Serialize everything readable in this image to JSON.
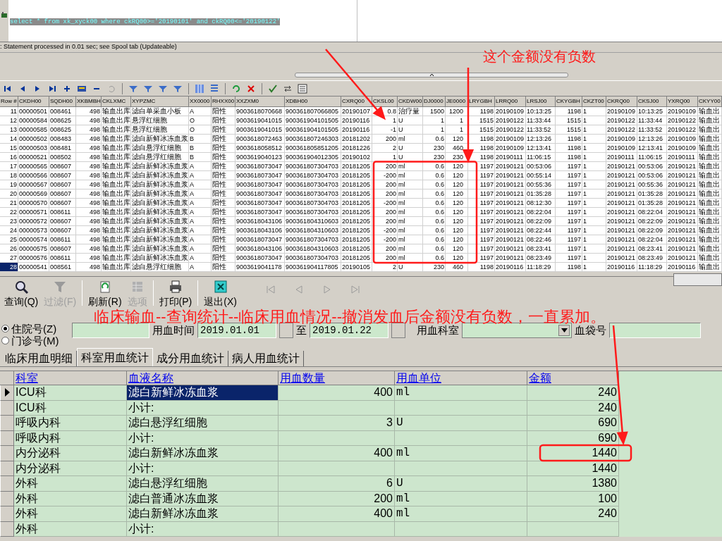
{
  "sql_editor": {
    "query": "select * from xk_xyck00 where ckRQ00>='20190101' and ckRQ00<='20190122'"
  },
  "status_message": ": Statement processed in 0.01 sec; see Spool tab (Updateable)",
  "result_grid": {
    "columns": [
      "Row #",
      "CKDH00",
      "SQDH00",
      "XKBMBH",
      "CKLXMC",
      "XYPZMC",
      "XX0000",
      "RHXX00",
      "XXZXM0",
      "XDBH00",
      "CXRQ00",
      "CKSL00",
      "CKDW00",
      "DJ0000",
      "JE0000",
      "LRYGBH",
      "LRRQ00",
      "LRSJ00",
      "CKYGBH",
      "CKZT00",
      "CKRQ00",
      "CKSJ00",
      "YXRQ00",
      "CKYY00"
    ],
    "rows": [
      {
        "selected": false,
        "cells": [
          "11",
          "00000501",
          "008461",
          "498",
          "输血出库",
          "滤白单采血小板",
          "A",
          "阳性",
          "9003618070668",
          "900361807066805",
          "20190107",
          "0.8",
          "治疗量",
          "1500",
          "1200",
          "1198",
          "20190109",
          "10:13:25",
          "1198",
          "1",
          "20190109",
          "10:13:25",
          "20190109",
          "输血出"
        ]
      },
      {
        "selected": false,
        "cells": [
          "12",
          "00000584",
          "008625",
          "498",
          "输血出库",
          "悬浮红细胞",
          "O",
          "阳性",
          "9003619041015",
          "900361904101505",
          "20190116",
          "1",
          "U",
          "1",
          "1",
          "1515",
          "20190122",
          "11:33:44",
          "1515",
          "1",
          "20190122",
          "11:33:44",
          "20190122",
          "输血出"
        ]
      },
      {
        "selected": false,
        "cells": [
          "13",
          "00000585",
          "008625",
          "498",
          "输血出库",
          "悬浮红细胞",
          "O",
          "阳性",
          "9003619041015",
          "900361904101505",
          "20190116",
          "-1",
          "U",
          "1",
          "1",
          "1515",
          "20190122",
          "11:33:52",
          "1515",
          "1",
          "20190122",
          "11:33:52",
          "20190122",
          "输血出"
        ]
      },
      {
        "selected": false,
        "cells": [
          "14",
          "00000502",
          "008483",
          "498",
          "输血出库",
          "滤白新鲜冰冻血浆",
          "B",
          "阳性",
          "9003618072463",
          "900361807246303",
          "20181202",
          "200",
          "ml",
          "0.6",
          "120",
          "1198",
          "20190109",
          "12:13:26",
          "1198",
          "1",
          "20190109",
          "12:13:26",
          "20190109",
          "输血出"
        ]
      },
      {
        "selected": false,
        "cells": [
          "15",
          "00000503",
          "008481",
          "498",
          "输血出库",
          "滤白悬浮红细胞",
          "B",
          "阳性",
          "9003618058512",
          "900361805851205",
          "20181226",
          "2",
          "U",
          "230",
          "460",
          "1198",
          "20190109",
          "12:13:41",
          "1198",
          "1",
          "20190109",
          "12:13:41",
          "20190109",
          "输血出"
        ]
      },
      {
        "selected": false,
        "cells": [
          "16",
          "00000521",
          "008502",
          "498",
          "输血出库",
          "滤白悬浮红细胞",
          "B",
          "阳性",
          "9003619040123",
          "900361904012305",
          "20190102",
          "1",
          "U",
          "230",
          "230",
          "1198",
          "20190111",
          "11:06:15",
          "1198",
          "1",
          "20190111",
          "11:06:15",
          "20190111",
          "输血出"
        ]
      },
      {
        "selected": false,
        "cells": [
          "17",
          "00000565",
          "008607",
          "498",
          "输血出库",
          "滤白新鲜冰冻血浆",
          "A",
          "阳性",
          "9003618073047",
          "900361807304703",
          "20181205",
          "200",
          "ml",
          "0.6",
          "120",
          "1197",
          "20190121",
          "00:53:06",
          "1197",
          "1",
          "20190121",
          "00:53:06",
          "20190121",
          "输血出"
        ]
      },
      {
        "selected": false,
        "cells": [
          "18",
          "00000566",
          "008607",
          "498",
          "输血出库",
          "滤白新鲜冰冻血浆",
          "A",
          "阳性",
          "9003618073047",
          "900361807304703",
          "20181205",
          "-200",
          "ml",
          "0.6",
          "120",
          "1197",
          "20190121",
          "00:55:14",
          "1197",
          "1",
          "20190121",
          "00:53:06",
          "20190121",
          "输血出"
        ]
      },
      {
        "selected": false,
        "cells": [
          "19",
          "00000567",
          "008607",
          "498",
          "输血出库",
          "滤白新鲜冰冻血浆",
          "A",
          "阳性",
          "9003618073047",
          "900361807304703",
          "20181205",
          "200",
          "ml",
          "0.6",
          "120",
          "1197",
          "20190121",
          "00:55:36",
          "1197",
          "1",
          "20190121",
          "00:55:36",
          "20190121",
          "输血出"
        ]
      },
      {
        "selected": false,
        "cells": [
          "20",
          "00000569",
          "008607",
          "498",
          "输血出库",
          "滤白新鲜冰冻血浆",
          "A",
          "阳性",
          "9003618073047",
          "900361807304703",
          "20181205",
          "200",
          "ml",
          "0.6",
          "120",
          "1197",
          "20190121",
          "01:35:28",
          "1197",
          "1",
          "20190121",
          "01:35:28",
          "20190121",
          "输血出"
        ]
      },
      {
        "selected": false,
        "cells": [
          "21",
          "00000570",
          "008607",
          "498",
          "输血出库",
          "滤白新鲜冰冻血浆",
          "A",
          "阳性",
          "9003618073047",
          "900361807304703",
          "20181205",
          "-200",
          "ml",
          "0.6",
          "120",
          "1197",
          "20190121",
          "08:12:30",
          "1197",
          "1",
          "20190121",
          "01:35:28",
          "20190121",
          "输血出"
        ]
      },
      {
        "selected": false,
        "cells": [
          "22",
          "00000571",
          "008611",
          "498",
          "输血出库",
          "滤白新鲜冰冻血浆",
          "A",
          "阳性",
          "9003618073047",
          "900361807304703",
          "20181205",
          "200",
          "ml",
          "0.6",
          "120",
          "1197",
          "20190121",
          "08:22:04",
          "1197",
          "1",
          "20190121",
          "08:22:04",
          "20190121",
          "输血出"
        ]
      },
      {
        "selected": false,
        "cells": [
          "23",
          "00000572",
          "008607",
          "498",
          "输血出库",
          "滤白新鲜冰冻血浆",
          "A",
          "阳性",
          "9003618043106",
          "900361804310603",
          "20181205",
          "200",
          "ml",
          "0.6",
          "120",
          "1197",
          "20190121",
          "08:22:09",
          "1197",
          "1",
          "20190121",
          "08:22:09",
          "20190121",
          "输血出"
        ]
      },
      {
        "selected": false,
        "cells": [
          "24",
          "00000573",
          "008607",
          "498",
          "输血出库",
          "滤白新鲜冰冻血浆",
          "A",
          "阳性",
          "9003618043106",
          "900361804310603",
          "20181205",
          "-200",
          "ml",
          "0.6",
          "120",
          "1197",
          "20190121",
          "08:22:44",
          "1197",
          "1",
          "20190121",
          "08:22:09",
          "20190121",
          "输血出"
        ]
      },
      {
        "selected": false,
        "cells": [
          "25",
          "00000574",
          "008611",
          "498",
          "输血出库",
          "滤白新鲜冰冻血浆",
          "A",
          "阳性",
          "9003618073047",
          "900361807304703",
          "20181205",
          "-200",
          "ml",
          "0.6",
          "120",
          "1197",
          "20190121",
          "08:22:46",
          "1197",
          "1",
          "20190121",
          "08:22:04",
          "20190121",
          "输血出"
        ]
      },
      {
        "selected": false,
        "cells": [
          "26",
          "00000575",
          "008607",
          "498",
          "输血出库",
          "滤白新鲜冰冻血浆",
          "A",
          "阳性",
          "9003618043106",
          "900361804310603",
          "20181205",
          "200",
          "ml",
          "0.6",
          "120",
          "1197",
          "20190121",
          "08:23:41",
          "1197",
          "1",
          "20190121",
          "08:23:41",
          "20190121",
          "输血出"
        ]
      },
      {
        "selected": false,
        "cells": [
          "27",
          "00000576",
          "008611",
          "498",
          "输血出库",
          "滤白新鲜冰冻血浆",
          "A",
          "阳性",
          "9003618073047",
          "900361807304703",
          "20181205",
          "200",
          "ml",
          "0.6",
          "120",
          "1197",
          "20190121",
          "08:23:49",
          "1197",
          "1",
          "20190121",
          "08:23:49",
          "20190121",
          "输血出"
        ]
      },
      {
        "selected": true,
        "cells": [
          "28",
          "00000541",
          "008561",
          "498",
          "输血出库",
          "滤白悬浮红细胞",
          "A",
          "阳性",
          "9003619041178",
          "900361904117805",
          "20190105",
          "2",
          "U",
          "230",
          "460",
          "1198",
          "20190116",
          "11:18:29",
          "1198",
          "1",
          "20190116",
          "11:18:29",
          "20190116",
          "输血出"
        ]
      }
    ]
  },
  "annotations": [
    {
      "kind": "note",
      "text": "这个金额没有负数"
    },
    {
      "kind": "caption",
      "text": "临床输血--查询统计--临床用血情况--撤消发血后金额没有负数，一直累加。"
    }
  ],
  "toolbar": [
    {
      "kind": "search",
      "label": "查询(Q)",
      "disabled": false
    },
    {
      "kind": "filter",
      "label": "过滤(F)",
      "disabled": true
    },
    {
      "kind": "refresh",
      "label": "刷新(R)",
      "disabled": false
    },
    {
      "kind": "options",
      "label": "选项",
      "disabled": true
    },
    {
      "kind": "print",
      "label": "打印(P)",
      "disabled": false
    },
    {
      "kind": "exit",
      "label": "退出(X)",
      "disabled": false
    }
  ],
  "nav_buttons": [
    {
      "kind": "first",
      "disabled": true
    },
    {
      "kind": "prev",
      "disabled": true
    },
    {
      "kind": "next",
      "disabled": true
    },
    {
      "kind": "last",
      "disabled": true
    }
  ],
  "patient_type": [
    {
      "label": "住院号(Z)",
      "selected": true
    },
    {
      "label": "门诊号(M)",
      "selected": false
    }
  ],
  "filters": {
    "date_label": "用血时间",
    "date_from": "2019.01.01",
    "to_label": "至",
    "date_to": "2019.01.22",
    "department_label": "用血科室",
    "bag_label": "血袋号"
  },
  "tabs": [
    {
      "label": "临床用血明细",
      "selected": false
    },
    {
      "label": "科室用血统计",
      "selected": true
    },
    {
      "label": "成分用血统计",
      "selected": false
    },
    {
      "label": "病人用血统计",
      "selected": false
    }
  ],
  "summary_grid": {
    "columns": [
      "科室",
      "血液名称",
      "用血数量",
      "用血单位",
      "金额"
    ],
    "rows": [
      {
        "selected": true,
        "cells": [
          "ICU科",
          "滤白新鲜冰冻血浆",
          "400",
          "ml",
          "240"
        ]
      },
      {
        "selected": false,
        "cells": [
          "ICU科",
          "小计:",
          "",
          "",
          "240"
        ]
      },
      {
        "selected": false,
        "cells": [
          "呼吸内科",
          "滤白悬浮红细胞",
          "3",
          "U",
          "690"
        ]
      },
      {
        "selected": false,
        "cells": [
          "呼吸内科",
          "小计:",
          "",
          "",
          "690"
        ]
      },
      {
        "selected": false,
        "cells": [
          "内分泌科",
          "滤白新鲜冰冻血浆",
          "400",
          "ml",
          "1440"
        ]
      },
      {
        "selected": false,
        "cells": [
          "内分泌科",
          "小计:",
          "",
          "",
          "1440"
        ]
      },
      {
        "selected": false,
        "cells": [
          "外科",
          "滤白悬浮红细胞",
          "6",
          "U",
          "1380"
        ]
      },
      {
        "selected": false,
        "cells": [
          "外科",
          "滤白普通冰冻血浆",
          "200",
          "ml",
          "100"
        ]
      },
      {
        "selected": false,
        "cells": [
          "外科",
          "滤白新鲜冰冻血浆",
          "400",
          "ml",
          "240"
        ]
      },
      {
        "selected": false,
        "cells": [
          "外科",
          "小计:",
          "",
          "",
          ""
        ]
      }
    ]
  }
}
